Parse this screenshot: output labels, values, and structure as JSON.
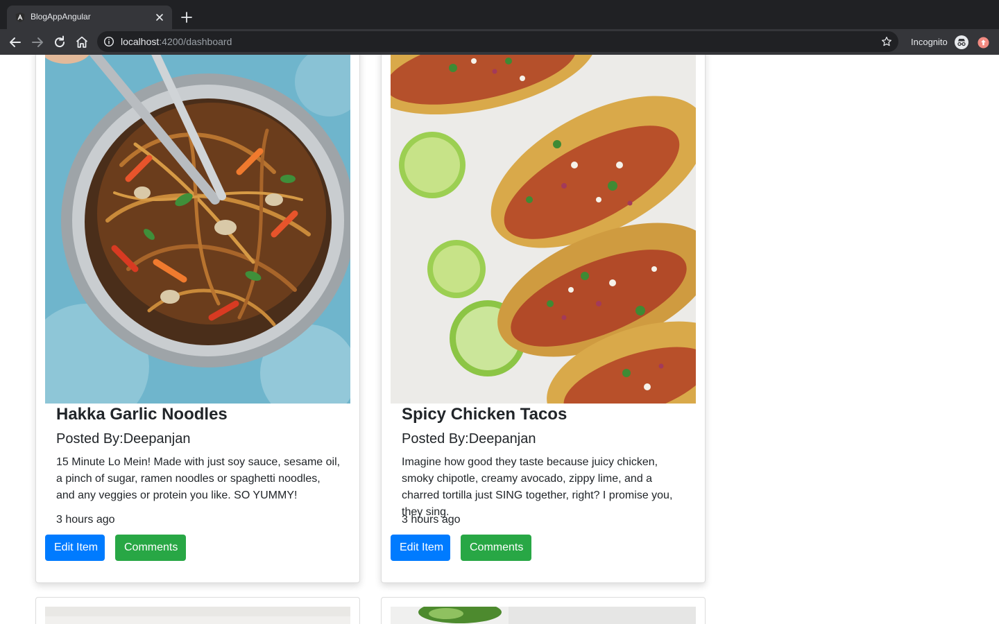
{
  "browser": {
    "tab_title": "BlogAppAngular",
    "url_host": "localhost",
    "url_path": ":4200/dashboard",
    "profile_label": "Incognito"
  },
  "icons": {
    "tab_favicon": "angular-logo-icon",
    "tab_close": "close-icon",
    "new_tab": "plus-icon",
    "back": "arrow-left-icon",
    "forward": "arrow-right-icon",
    "reload": "reload-icon",
    "home": "home-icon",
    "site_info": "info-icon",
    "bookmark": "star-icon",
    "incognito": "incognito-icon",
    "extension": "extension-icon"
  },
  "colors": {
    "edit_button": "#007bff",
    "comments_button": "#28a745",
    "chrome_dark": "#202124",
    "chrome_toolbar": "#35363a"
  },
  "posts": [
    {
      "title": "Hakka Garlic Noodles",
      "author_line": "Posted By:Deepanjan",
      "description": "15 Minute Lo Mein! Made with just soy sauce, sesame oil, a pinch of sugar, ramen noodles or spaghetti noodles, and any veggies or protein you like. SO YUMMY!",
      "time": "3 hours ago",
      "edit_label": "Edit Item",
      "comments_label": "Comments"
    },
    {
      "title": "Spicy Chicken Tacos",
      "author_line": "Posted By:Deepanjan",
      "description": "Imagine how good they taste because juicy chicken, smoky chipotle, creamy avocado, zippy lime, and a charred tortilla just SING together, right? I promise you, they sing.",
      "time": "3 hours ago",
      "edit_label": "Edit Item",
      "comments_label": "Comments"
    }
  ]
}
